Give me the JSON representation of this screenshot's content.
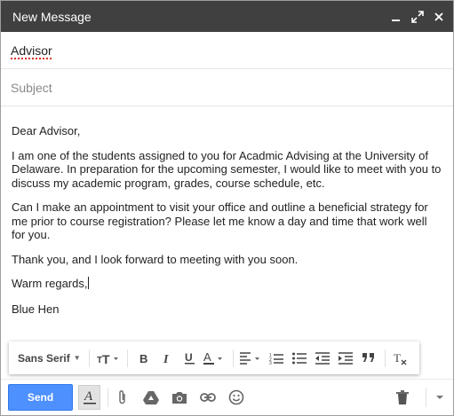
{
  "window": {
    "title": "New Message",
    "controls": [
      "minimize-icon",
      "expand-icon",
      "close-icon"
    ]
  },
  "to": {
    "recipient": "Advisor"
  },
  "subject": {
    "placeholder": "Subject"
  },
  "body": {
    "greeting": "Dear  Advisor,",
    "paragraph1": "I am one of the students assigned to you for Acadmic Advising at the University of Delaware. In preparation for the upcoming semester, I would like to meet with you to discuss my academic program, grades, course schedule, etc.",
    "paragraph2": "Can I make an appointment to visit your office and outline a beneficial strategy for me prior to course registration? Please let me know a day and time that work well for you.",
    "paragraph3": "Thank you, and I look forward to meeting with you soon.",
    "closing": "Warm regards,",
    "signature": "Blue Hen"
  },
  "format_toolbar": {
    "font": "Sans Serif",
    "buttons": [
      "font-size-icon",
      "bold-icon",
      "italic-icon",
      "underline-icon",
      "text-color-icon",
      "align-icon",
      "numbered-list-icon",
      "bulleted-list-icon",
      "indent-less-icon",
      "indent-more-icon",
      "quote-icon",
      "remove-formatting-icon"
    ]
  },
  "bottom_bar": {
    "send_label": "Send",
    "icons": [
      "formatting-options-icon",
      "attach-icon",
      "drive-icon",
      "camera-icon",
      "link-icon",
      "emoji-icon",
      "trash-icon",
      "more-options-icon"
    ],
    "accent_color": "#4d90fe"
  }
}
